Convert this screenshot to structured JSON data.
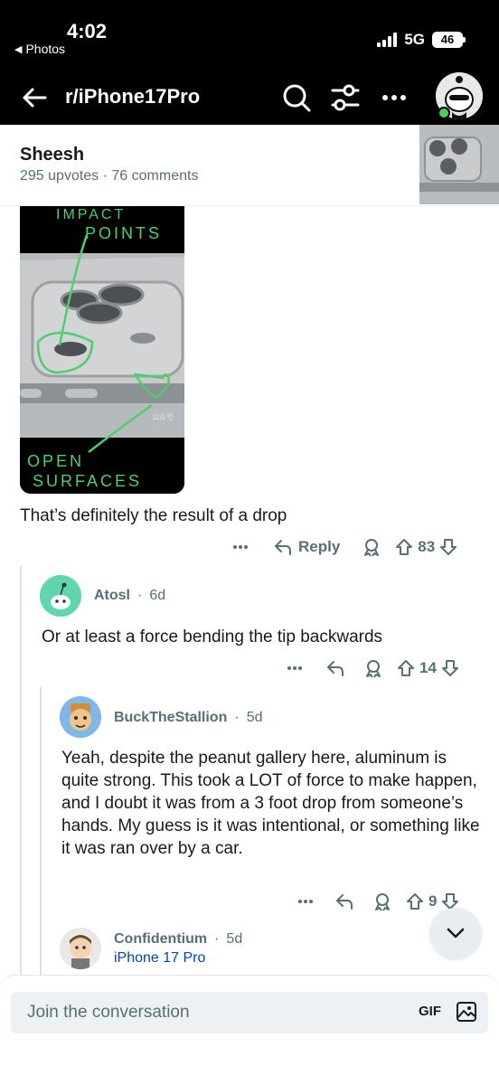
{
  "status_bar": {
    "time": "4:02",
    "back_app": "Photos",
    "network": "5G",
    "battery": "46"
  },
  "header": {
    "subreddit": "r/iPhone17Pro"
  },
  "post": {
    "title": "Sheesh",
    "meta": "295 upvotes · 76 comments"
  },
  "image_annotations": {
    "top": [
      "IMPACT",
      "POINTS"
    ],
    "bottom": [
      "OPEN",
      "SURFACES"
    ],
    "watermark": "公众号"
  },
  "comments": [
    {
      "text": "That’s definitely the result of a drop",
      "reply_label": "Reply",
      "score": "83"
    },
    {
      "author": "Atosl",
      "age": "6d",
      "text": "Or at least a force bending the tip backwards",
      "score": "14"
    },
    {
      "author": "BuckTheStallion",
      "age": "5d",
      "text": "Yeah, despite the peanut gallery here, aluminum is quite strong. This took a LOT of force to make happen, and I doubt it was from a 3 foot drop from someone’s hands. My guess is it was intentional, or something like it was ran over by a car.",
      "score": "9"
    },
    {
      "author": "Confidentium",
      "age": "5d",
      "flair": "iPhone 17 Pro"
    }
  ],
  "composer": {
    "placeholder": "Join the conversation",
    "gif_label": "GIF"
  },
  "colors": {
    "header_bg": "#000000",
    "meta_text": "#576f76",
    "link_blue": "#0045ac",
    "online": "#46d160"
  }
}
